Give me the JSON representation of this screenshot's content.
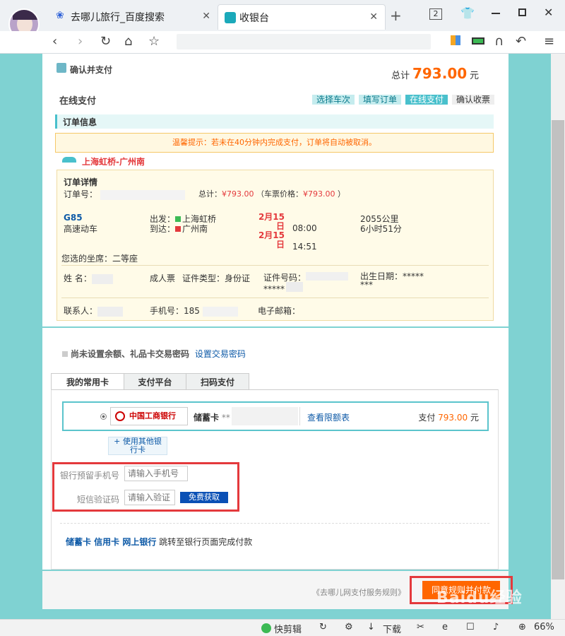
{
  "browser": {
    "tabs": [
      {
        "label": "去哪儿旅行_百度搜索"
      },
      {
        "label": "收银台"
      }
    ],
    "tab_count": "2",
    "new_tab": "+",
    "close": "✕"
  },
  "header": {
    "confirm_label": "确认并支付",
    "total_label": "总计",
    "total_amount": "793.00",
    "total_unit": "元",
    "online_pay": "在线支付",
    "steps": [
      "选择车次",
      "填写订单",
      "在线支付",
      "确认收票"
    ],
    "active_step": 2
  },
  "order": {
    "section_title": "订单信息",
    "warning": "温馨提示：若未在40分钟内完成支付，订单将自动被取消。",
    "route": "上海虹桥-广州南",
    "details_title": "订单详情",
    "order_no_label": "订单号：",
    "total_label": "总计：",
    "total_value": "¥793.00",
    "ticket_price_label": "（车票价格：",
    "ticket_price_value": "¥793.00",
    "ticket_price_close": " ）",
    "train_no": "G85",
    "train_type": "高速动车",
    "depart_label": "出发：",
    "depart_station": "上海虹桥",
    "arrive_label": "到达：",
    "arrive_station": "广州南",
    "depart_date": "2月15",
    "depart_date2": "日",
    "arrive_date": "2月15",
    "arrive_date2": "日",
    "depart_time": "08:00",
    "arrive_time": "14:51",
    "distance": "2055公里",
    "duration": "6小时51分",
    "seat": "您选的坐席：二等座",
    "name_label": "姓 名：",
    "ticket_type": "成人票",
    "id_type_label": "证件类型：身份证",
    "id_no_label": "证件号码：",
    "id_mask": "*****",
    "birth_label": "出生日期：",
    "birth_mask": "*****",
    "birth_mask2": "***",
    "contact_label": "联系人：",
    "phone_label": "手机号：",
    "phone_prefix": "185",
    "email_label": "电子邮箱："
  },
  "payment": {
    "password_notice": "尚未设置余额、礼品卡交易密码",
    "set_password": "设置交易密码",
    "tabs": [
      "我的常用卡",
      "支付平台",
      "扫码支付"
    ],
    "bank_name": "中国工商银行",
    "card_type": "储蓄卡",
    "card_mask": "**",
    "limit_link": "查看限额表",
    "pay_label": "支付",
    "pay_amount": "793.00",
    "pay_unit": "元",
    "other_bank_1": "+ 使用其他银",
    "other_bank_2": "行卡",
    "phone_label": "银行预留手机号",
    "phone_placeholder": "请输入手机号",
    "sms_label": "短信验证码",
    "sms_placeholder": "请输入验证",
    "sms_button": "免费获取",
    "netbank_links": "储蓄卡 信用卡 网上银行",
    "netbank_hint": "跳转至银行页面完成付款",
    "agreement": "《去哪儿网支付服务规则》",
    "submit": "同意规则并付款"
  },
  "statusbar": {
    "quick_edit": "快剪辑",
    "download": "下载",
    "zoom": "66%"
  },
  "watermark": "Baidu经验",
  "colors": {
    "accent": "#f60",
    "teal": "#7fd2d2",
    "highlight": "#e4393c"
  }
}
